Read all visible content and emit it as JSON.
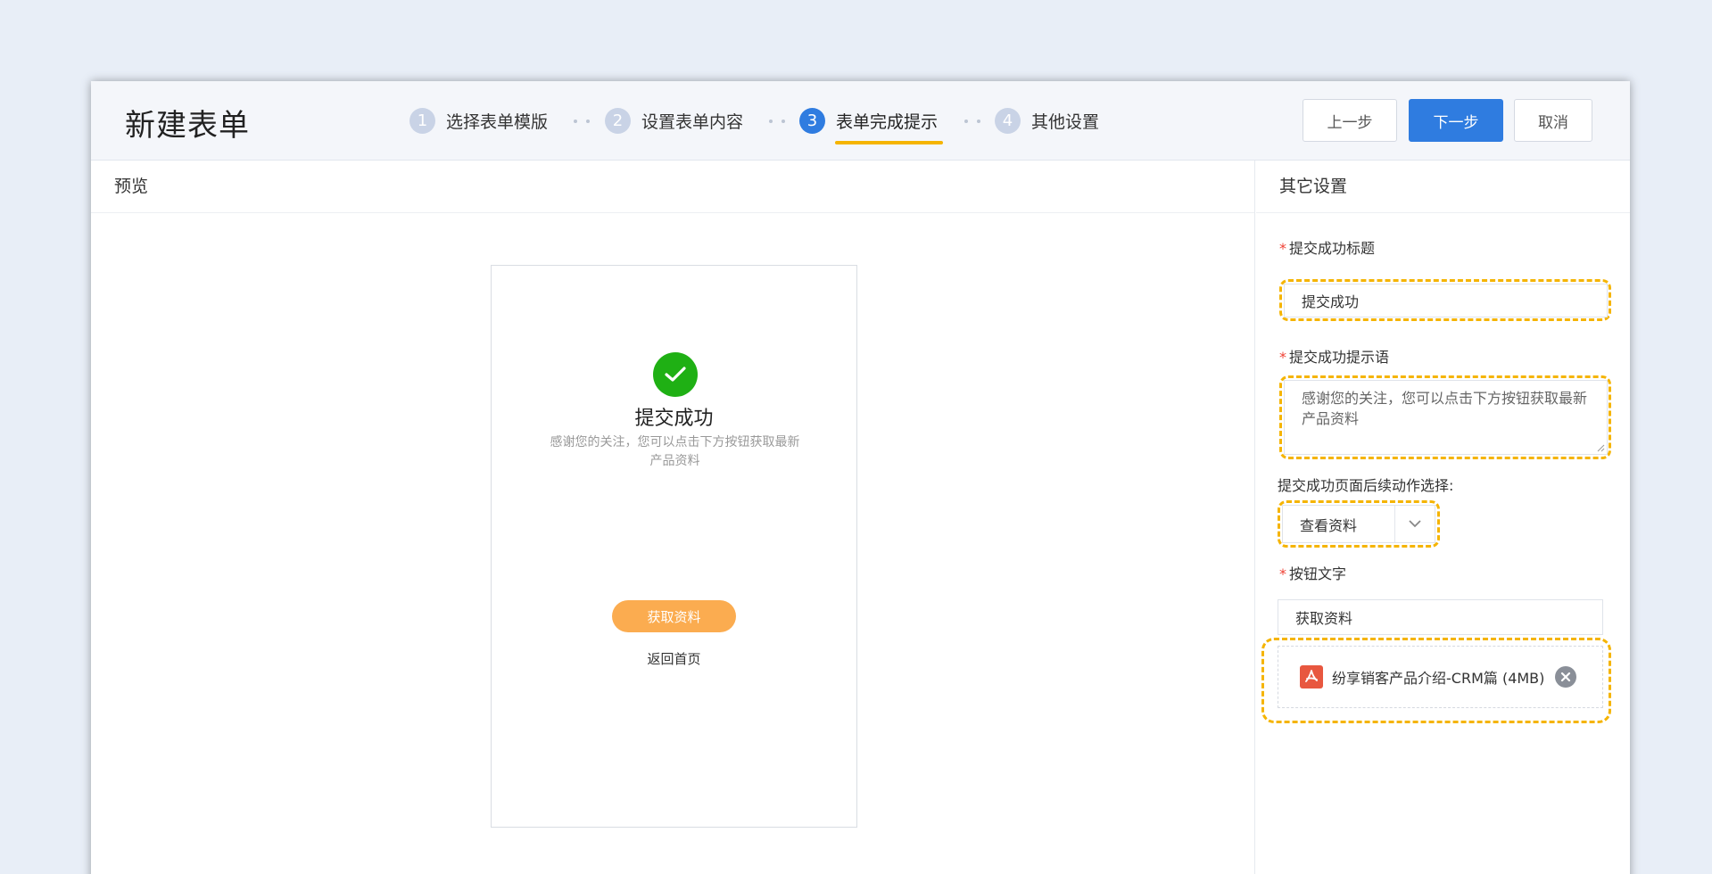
{
  "header": {
    "title": "新建表单",
    "steps": [
      {
        "num": "1",
        "label": "选择表单模版"
      },
      {
        "num": "2",
        "label": "设置表单内容"
      },
      {
        "num": "3",
        "label": "表单完成提示"
      },
      {
        "num": "4",
        "label": "其他设置"
      }
    ],
    "active_step": 3,
    "buttons": {
      "prev": "上一步",
      "next": "下一步",
      "cancel": "取消"
    }
  },
  "preview": {
    "header": "预览",
    "success_title": "提交成功",
    "success_message": "感谢您的关注，您可以点击下方按钮获取最新产品资料",
    "action_button": "获取资料",
    "home_link": "返回首页"
  },
  "settings": {
    "header": "其它设置",
    "title_label": "提交成功标题",
    "title_value": "提交成功",
    "message_label": "提交成功提示语",
    "message_value": "感谢您的关注，您可以点击下方按钮获取最新产品资料",
    "action_label": "提交成功页面后续动作选择:",
    "action_value": "查看资料",
    "button_text_label": "按钮文字",
    "button_text_value": "获取资料",
    "file_name": "纷享销客产品介绍-CRM篇 (4MB)"
  },
  "colors": {
    "primary": "#2f7ce0",
    "highlight": "#f5b400",
    "success": "#1fb014",
    "action_button": "#fbac50",
    "required": "#f04134"
  },
  "icons": [
    "check-icon",
    "chevron-down-icon",
    "pdf-icon",
    "close-icon"
  ]
}
